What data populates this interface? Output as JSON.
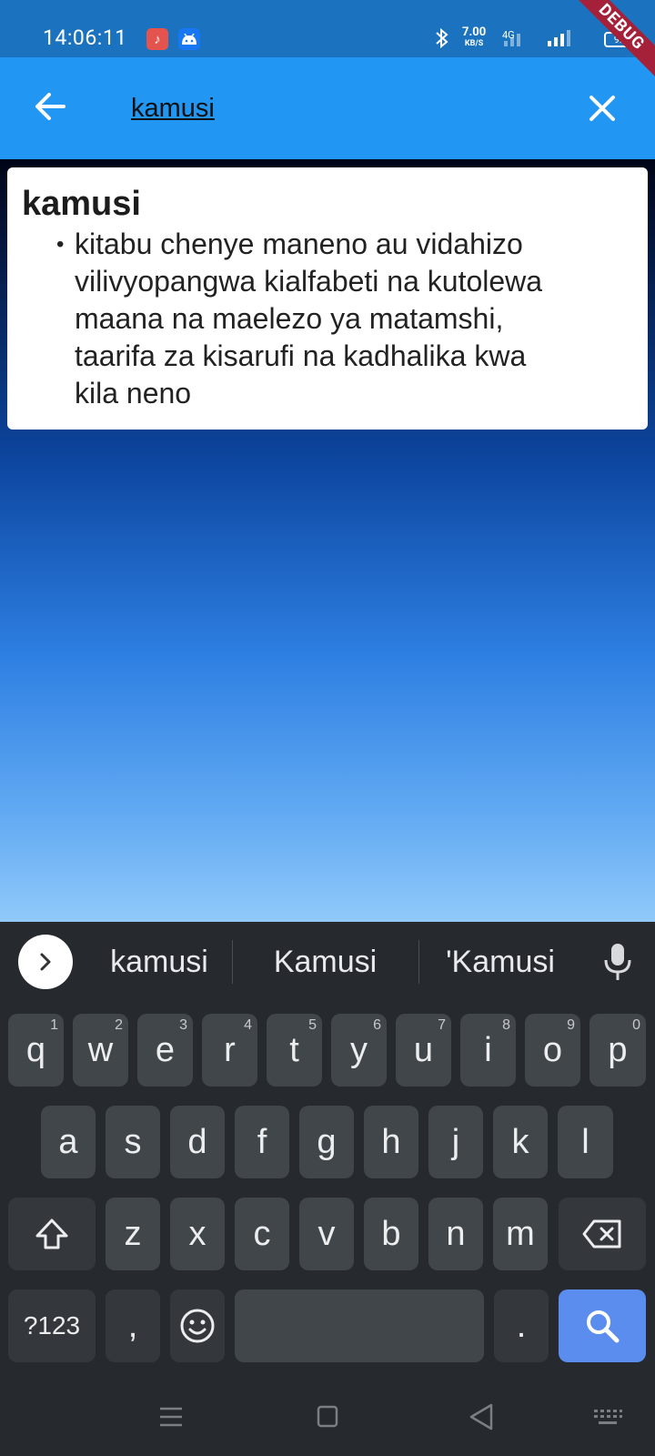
{
  "status_bar": {
    "time": "14:06:11",
    "speed_value": "7.00",
    "speed_unit": "KB/S",
    "network": "4G",
    "battery": "92",
    "icons": [
      "music-icon",
      "android-icon",
      "bluetooth-icon",
      "signal-icon",
      "battery-icon"
    ],
    "debug_label": "DEBUG"
  },
  "app_bar": {
    "search_value": "kamusi",
    "back_icon": "arrow-left-icon",
    "clear_icon": "close-icon",
    "color": "#2196f3"
  },
  "result": {
    "word": "kamusi",
    "definitions": [
      {
        "lines": [
          "kitabu chenye maneno au vidahizo",
          "vilivyopangwa kialfabeti na kutolewa",
          "maana na maelezo ya matamshi,",
          "taarifa za kisarufi na kadhalika kwa",
          "kila neno"
        ]
      }
    ]
  },
  "keyboard": {
    "suggestions": [
      "kamusi",
      "Kamusi",
      "'Kamusi"
    ],
    "row1": [
      {
        "key": "q",
        "hint": "1"
      },
      {
        "key": "w",
        "hint": "2"
      },
      {
        "key": "e",
        "hint": "3"
      },
      {
        "key": "r",
        "hint": "4"
      },
      {
        "key": "t",
        "hint": "5"
      },
      {
        "key": "y",
        "hint": "6"
      },
      {
        "key": "u",
        "hint": "7"
      },
      {
        "key": "i",
        "hint": "8"
      },
      {
        "key": "o",
        "hint": "9"
      },
      {
        "key": "p",
        "hint": "0"
      }
    ],
    "row2": [
      "a",
      "s",
      "d",
      "f",
      "g",
      "h",
      "j",
      "k",
      "l"
    ],
    "row3": [
      "z",
      "x",
      "c",
      "v",
      "b",
      "n",
      "m"
    ],
    "row4": {
      "symbols": "?123",
      "comma": ",",
      "period": "."
    },
    "accent": "#5b8def"
  }
}
